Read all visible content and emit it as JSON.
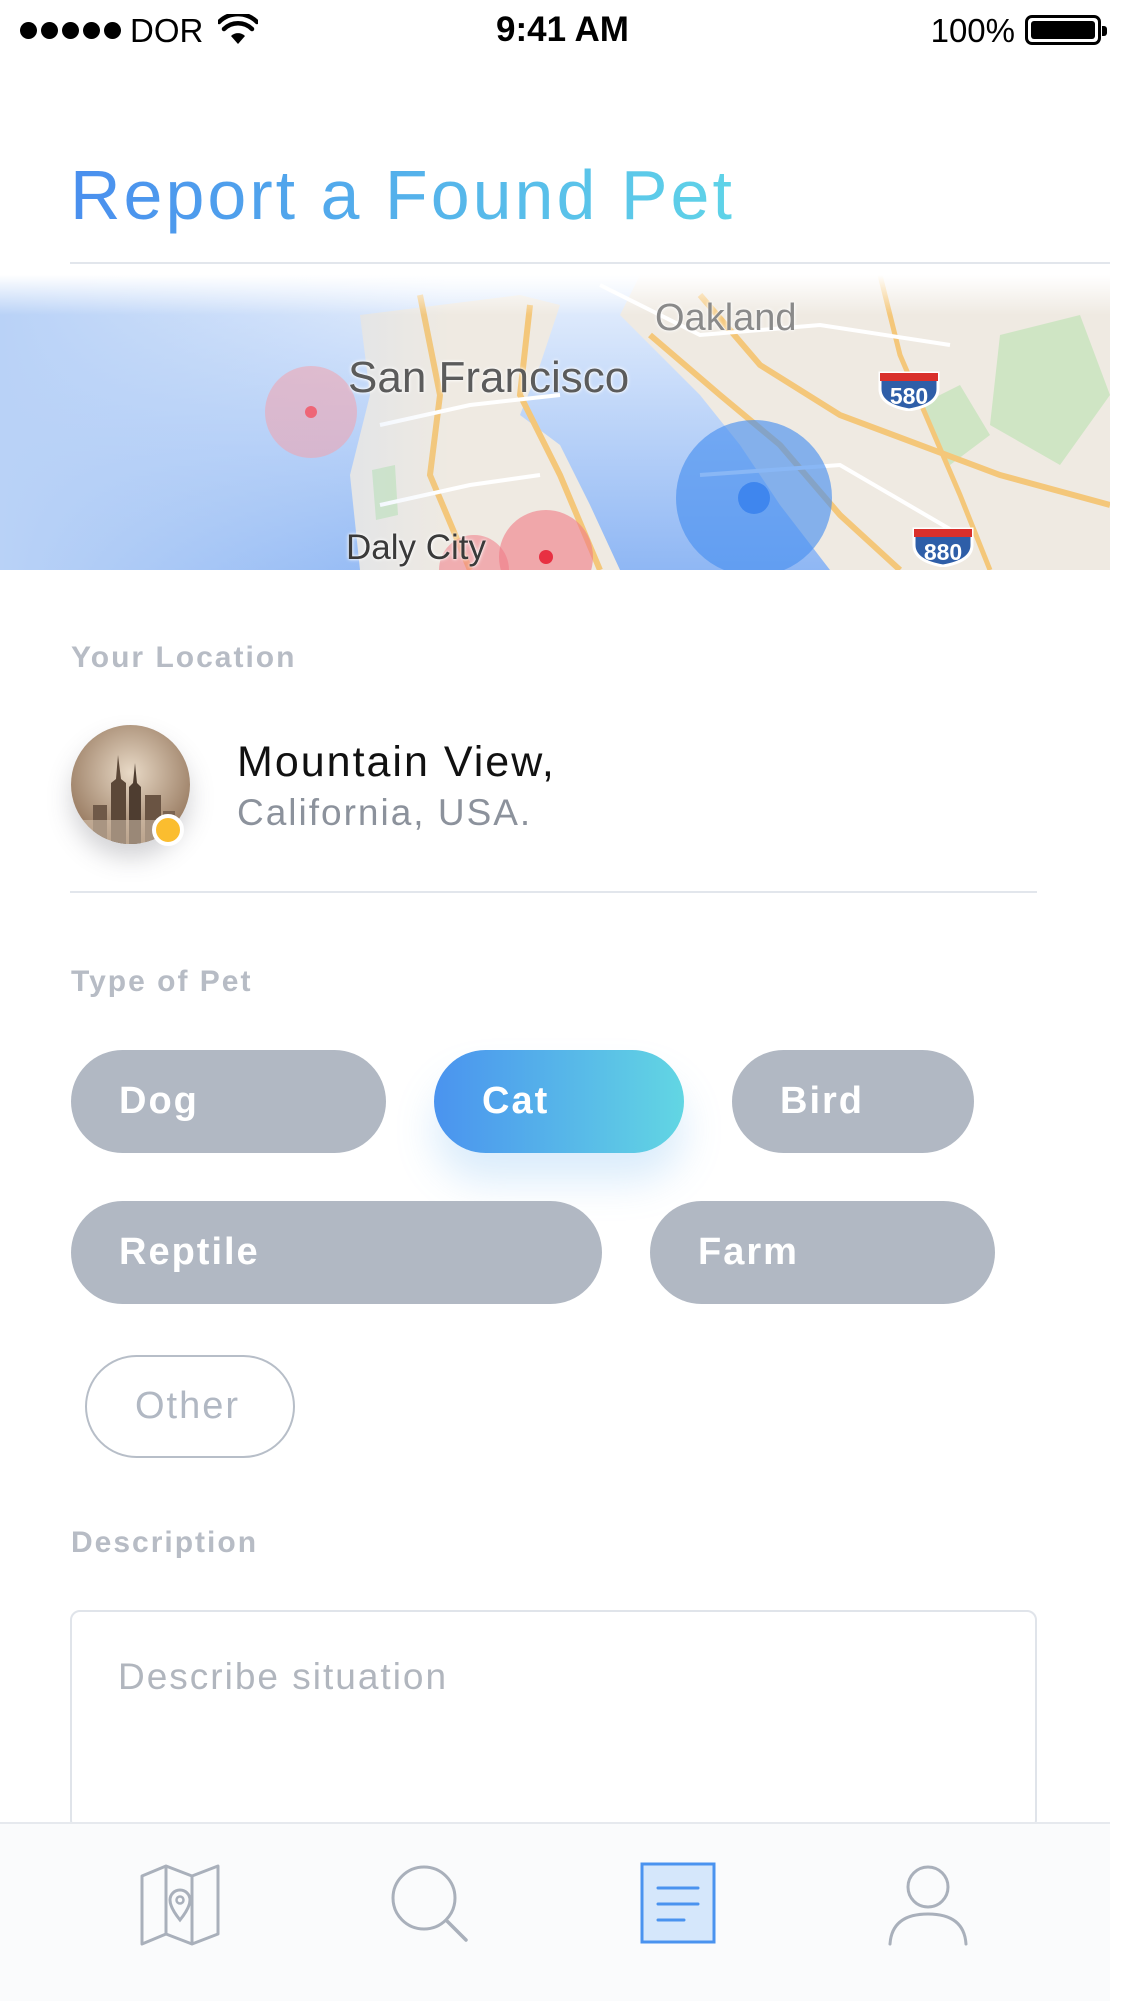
{
  "status_bar": {
    "carrier": "DOR",
    "time": "9:41 AM",
    "battery": "100%"
  },
  "title": "Report a Found Pet",
  "map": {
    "labels": {
      "oakland": "Oakland",
      "san_francisco": "San Francisco",
      "daly_city": "Daly City"
    },
    "highways": [
      "580",
      "880"
    ]
  },
  "location": {
    "label": "Your Location",
    "city": "Mountain View,",
    "region": "California, USA."
  },
  "pet_type": {
    "label": "Type of Pet",
    "options": [
      "Dog",
      "Cat",
      "Bird",
      "Reptile",
      "Farm",
      "Other"
    ],
    "selected": "Cat"
  },
  "description": {
    "label": "Description",
    "placeholder": "Describe situation"
  },
  "tab_bar": {
    "tabs": [
      "map-icon",
      "search-icon",
      "report-form-icon",
      "profile-icon"
    ],
    "active": "report-form-icon"
  },
  "colors": {
    "accent_start": "#4a8fee",
    "accent_end": "#5fd3e8",
    "pill_inactive": "#b1b8c3",
    "status_dot": "#fbbd2f"
  }
}
